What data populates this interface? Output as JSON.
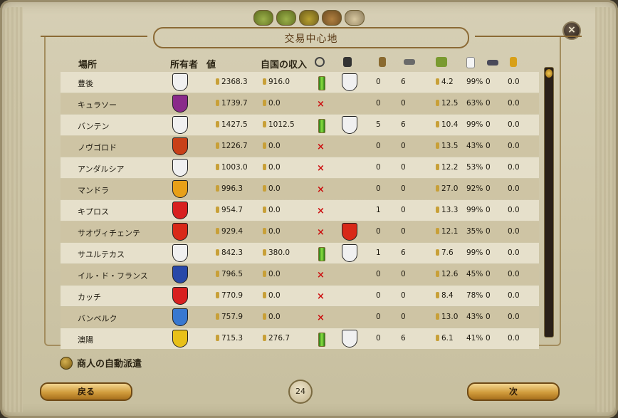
{
  "window": {
    "title": "交易中心地",
    "close_label": "×"
  },
  "top_icons": [
    "fleet-icon",
    "trade-icon",
    "castle-icon",
    "cargo-icon",
    "ship-icon"
  ],
  "headers": {
    "city": "場所",
    "owner": "所有者",
    "value": "値",
    "own_income": "自国の収入"
  },
  "header_icons": [
    "target-icon",
    "merchant-hat-icon",
    "chair-icon",
    "handcuffs-icon",
    "goods-icon",
    "dice-icon",
    "cannon-icon",
    "arrow-icon"
  ],
  "rows": [
    {
      "city": "豊後",
      "value": "2368.3",
      "income": "916.0",
      "status": "on",
      "owner_color": "#f0f0f0",
      "owner2_color": "#f0f0f0",
      "c1": "0",
      "c2": "6",
      "c3": "4.2",
      "c4": "99%",
      "c5": "0",
      "c6": "0.0"
    },
    {
      "city": "キュラソー",
      "value": "1739.7",
      "income": "0.0",
      "status": "off",
      "owner_color": "#8a2a8a",
      "c1": "0",
      "c2": "0",
      "c3": "12.5",
      "c4": "63%",
      "c5": "0",
      "c6": "0.0"
    },
    {
      "city": "バンテン",
      "value": "1427.5",
      "income": "1012.5",
      "status": "on",
      "owner_color": "#f0f0f0",
      "owner2_color": "#f0f0f0",
      "c1": "5",
      "c2": "6",
      "c3": "10.4",
      "c4": "99%",
      "c5": "0",
      "c6": "0.0"
    },
    {
      "city": "ノヴゴロド",
      "value": "1226.7",
      "income": "0.0",
      "status": "off",
      "owner_color": "#c84018",
      "c1": "0",
      "c2": "0",
      "c3": "13.5",
      "c4": "43%",
      "c5": "0",
      "c6": "0.0"
    },
    {
      "city": "アンダルシア",
      "value": "1003.0",
      "income": "0.0",
      "status": "off",
      "owner_color": "#f0f0f0",
      "c1": "0",
      "c2": "0",
      "c3": "12.2",
      "c4": "53%",
      "c5": "0",
      "c6": "0.0"
    },
    {
      "city": "マンドラ",
      "value": "996.3",
      "income": "0.0",
      "status": "off",
      "owner_color": "#e8a018",
      "c1": "0",
      "c2": "0",
      "c3": "27.0",
      "c4": "92%",
      "c5": "0",
      "c6": "0.0"
    },
    {
      "city": "キプロス",
      "value": "954.7",
      "income": "0.0",
      "status": "off",
      "owner_color": "#d82020",
      "c1": "1",
      "c2": "0",
      "c3": "13.3",
      "c4": "99%",
      "c5": "0",
      "c6": "0.0"
    },
    {
      "city": "サオヴィチェンテ",
      "value": "929.4",
      "income": "0.0",
      "status": "off",
      "owner_color": "#d82818",
      "owner2_color": "#d82818",
      "c1": "0",
      "c2": "0",
      "c3": "12.1",
      "c4": "35%",
      "c5": "0",
      "c6": "0.0"
    },
    {
      "city": "サユルテカス",
      "value": "842.3",
      "income": "380.0",
      "status": "on",
      "owner_color": "#f0f0f0",
      "owner2_color": "#f0f0f0",
      "c1": "1",
      "c2": "6",
      "c3": "7.6",
      "c4": "99%",
      "c5": "0",
      "c6": "0.0"
    },
    {
      "city": "イル・ド・フランス",
      "value": "796.5",
      "income": "0.0",
      "status": "off",
      "owner_color": "#2848a8",
      "c1": "0",
      "c2": "0",
      "c3": "12.6",
      "c4": "45%",
      "c5": "0",
      "c6": "0.0"
    },
    {
      "city": "カッチ",
      "value": "770.9",
      "income": "0.0",
      "status": "off",
      "owner_color": "#d82020",
      "c1": "0",
      "c2": "0",
      "c3": "8.4",
      "c4": "78%",
      "c5": "0",
      "c6": "0.0"
    },
    {
      "city": "バンベルク",
      "value": "757.9",
      "income": "0.0",
      "status": "off",
      "owner_color": "#3878d0",
      "c1": "0",
      "c2": "0",
      "c3": "13.0",
      "c4": "43%",
      "c5": "0",
      "c6": "0.0"
    },
    {
      "city": "澳陽",
      "value": "715.3",
      "income": "276.7",
      "status": "on",
      "owner_color": "#e8c018",
      "owner2_color": "#f0f0f0",
      "c1": "0",
      "c2": "6",
      "c3": "6.1",
      "c4": "41%",
      "c5": "0",
      "c6": "0.0"
    }
  ],
  "auto_send_label": "商人の自動派遣",
  "buttons": {
    "back": "戻る",
    "next": "次"
  },
  "page_number": "24",
  "colors": {
    "button_gold": "#d19c3c",
    "row_light": "#e6e0cb",
    "row_dark": "#cec4a4",
    "status_red": "#cc1010",
    "status_green": "#8ae040"
  }
}
